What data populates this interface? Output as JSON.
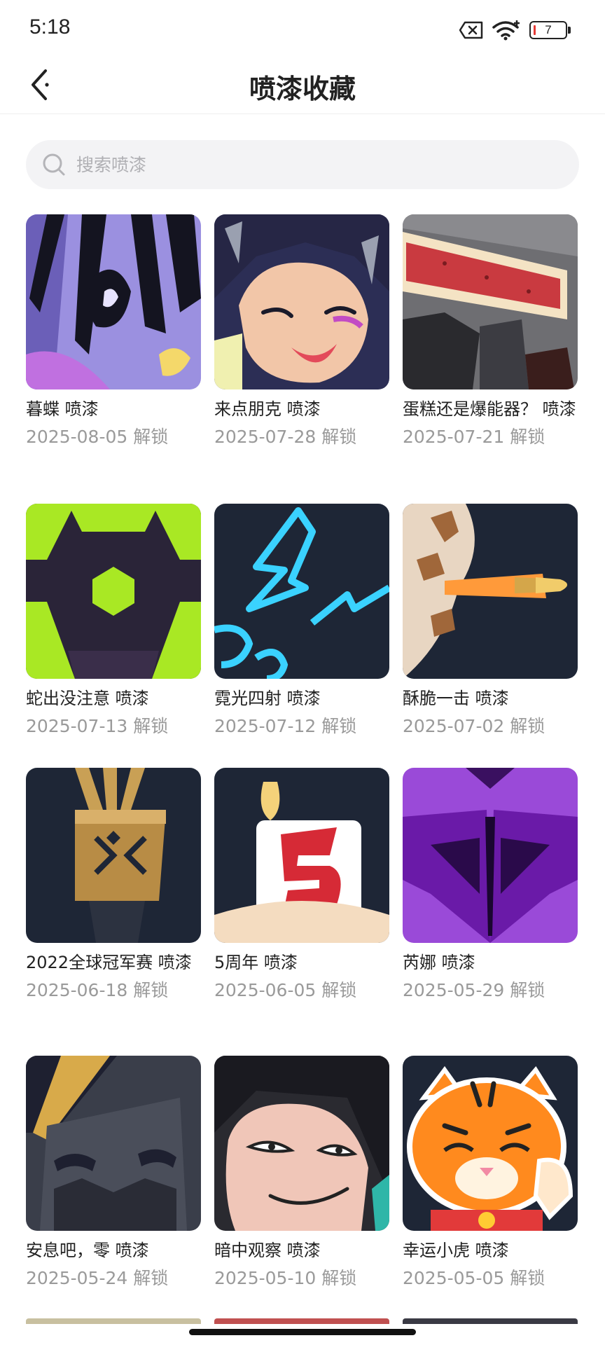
{
  "status_bar": {
    "time": "5:18",
    "battery": "7"
  },
  "header": {
    "title": "喷漆收藏"
  },
  "search": {
    "placeholder": "搜索喷漆"
  },
  "sprays": [
    {
      "name": "暮蝶 喷漆",
      "unlock": "2025-08-05 解锁",
      "icon": "butterfly-spray"
    },
    {
      "name": "来点朋克 喷漆",
      "unlock": "2025-07-28 解锁",
      "icon": "punk-girl-spray"
    },
    {
      "name": "蛋糕还是爆能器？ 喷漆",
      "unlock": "2025-07-21 解锁",
      "icon": "cake-spray"
    },
    {
      "name": "蛇出没注意 喷漆",
      "unlock": "2025-07-13 解锁",
      "icon": "snake-warning-spray"
    },
    {
      "name": "霓光四射 喷漆",
      "unlock": "2025-07-12 解锁",
      "icon": "neon-spray"
    },
    {
      "name": "酥脆一击 喷漆",
      "unlock": "2025-07-02 解锁",
      "icon": "bullet-spray"
    },
    {
      "name": "2022全球冠军赛 喷漆",
      "unlock": "2025-06-18 解锁",
      "icon": "champions-spray"
    },
    {
      "name": "5周年 喷漆",
      "unlock": "2025-06-05 解锁",
      "icon": "anniversary-cake-spray"
    },
    {
      "name": "芮娜 喷漆",
      "unlock": "2025-05-29 解锁",
      "icon": "reyna-spray"
    },
    {
      "name": "安息吧，零 喷漆",
      "unlock": "2025-05-24 解锁",
      "icon": "sleeping-robot-spray"
    },
    {
      "name": "暗中观察 喷漆",
      "unlock": "2025-05-10 解锁",
      "icon": "smirk-face-spray"
    },
    {
      "name": "幸运小虎 喷漆",
      "unlock": "2025-05-05 解锁",
      "icon": "lucky-tiger-spray"
    }
  ]
}
